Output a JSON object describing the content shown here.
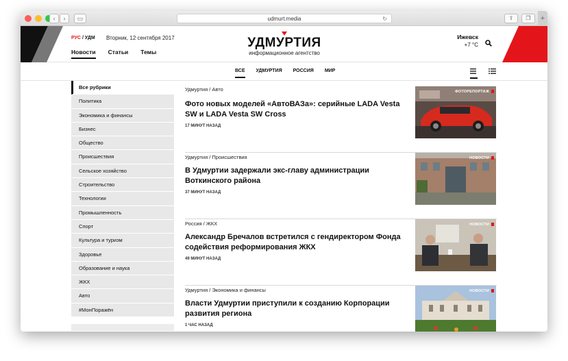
{
  "browser": {
    "url": "udmurt.media"
  },
  "header": {
    "lang_rus": "РУС",
    "lang_sep": " / ",
    "lang_udm": "УДМ",
    "date": "Вторник, 12 сентября 2017",
    "nav": [
      "Новости",
      "Статьи",
      "Темы"
    ],
    "logo_title": "УДМУРТИЯ",
    "logo_subtitle": "информационное агентство",
    "city": "Ижевск",
    "temperature": "+7 °С"
  },
  "tabs": [
    "ВСЕ",
    "УДМУРТИЯ",
    "РОССИЯ",
    "МИР"
  ],
  "sidebar": {
    "items": [
      "Все рубрики",
      "Политика",
      "Экономика и финансы",
      "Бизнес",
      "Общество",
      "Происшествия",
      "Сельское хозяйство",
      "Строительство",
      "Технологии",
      "Промышленность",
      "Спорт",
      "Культура и туризм",
      "Здоровье",
      "Образование и наука",
      "ЖКХ",
      "Авто",
      "#МонПоражён"
    ]
  },
  "feed": [
    {
      "category": "Удмуртия / Авто",
      "title": "Фото новых моделей «АвтоВАЗа»: серийные LADA Vesta SW и LADA Vesta SW Cross",
      "time": "17 МИНУТ НАЗАД",
      "badge": "ФОТОРЕПОРТАЖ"
    },
    {
      "category": "Удмуртия / Происшествия",
      "title": "В Удмуртии задержали экс-главу администрации Воткинского района",
      "time": "37 МИНУТ НАЗАД",
      "badge": "НОВОСТИ"
    },
    {
      "category": "Россия / ЖКХ",
      "title": "Александр Бречалов встретился с гендиректором Фонда содействия реформирования ЖКХ",
      "time": "49 МИНУТ НАЗАД",
      "badge": "НОВОСТИ"
    },
    {
      "category": "Удмуртия / Экономика и финансы",
      "title": "Власти Удмуртии приступили к созданию Корпорации развития региона",
      "time": "1 ЧАС НАЗАД",
      "badge": "НОВОСТИ"
    }
  ],
  "colors": {
    "accent": "#e3151a",
    "text": "#111111",
    "sidebar_bg": "#e8e8e8"
  }
}
